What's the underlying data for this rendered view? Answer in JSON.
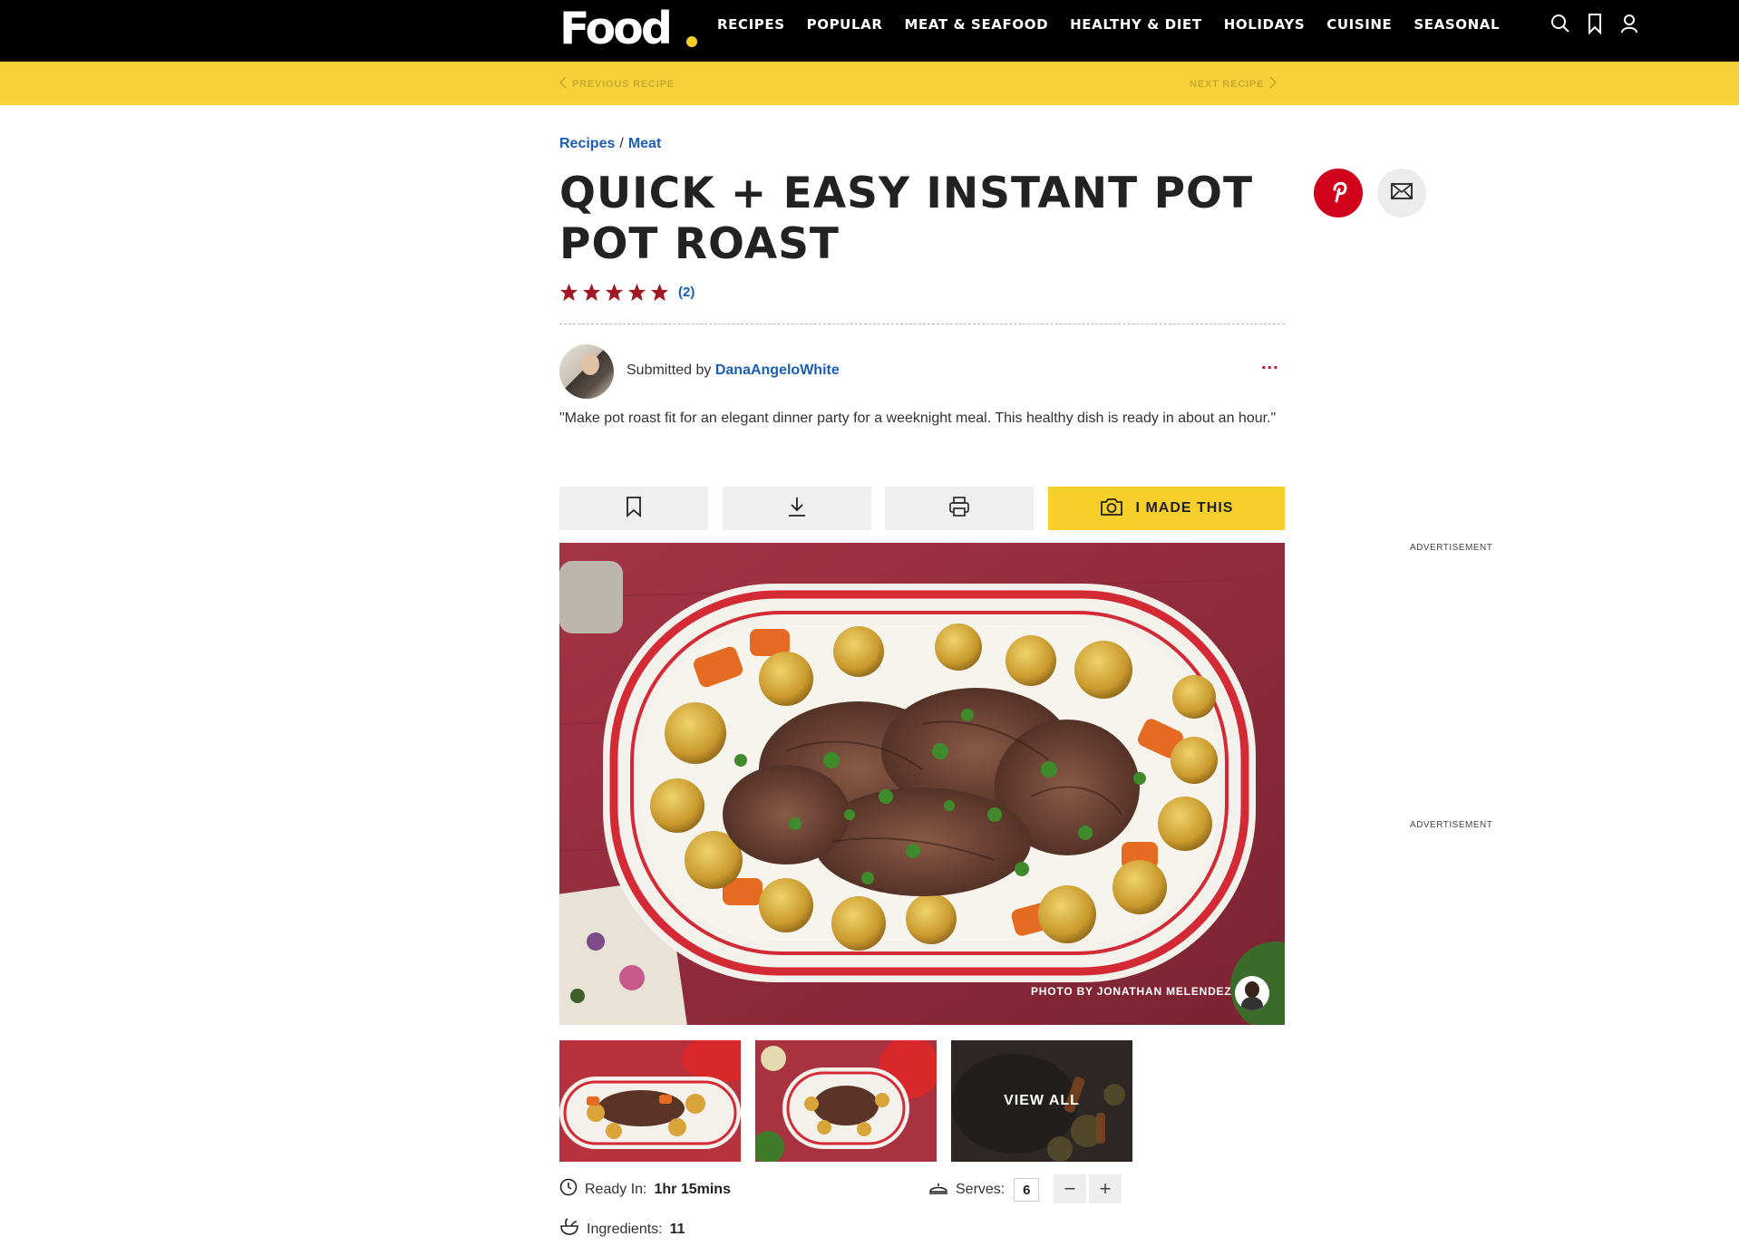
{
  "site": {
    "logo": "Food",
    "nav": [
      "RECIPES",
      "POPULAR",
      "MEAT & SEAFOOD",
      "HEALTHY & DIET",
      "HOLIDAYS",
      "CUISINE",
      "SEASONAL"
    ],
    "icons": [
      "search-icon",
      "bookmark-icon",
      "user-icon"
    ],
    "brand_yellow": "#f7d23a",
    "accent_blue": "#1a5db5"
  },
  "pager": {
    "previous": "PREVIOUS RECIPE",
    "next": "NEXT RECIPE"
  },
  "breadcrumb": {
    "first": "Recipes",
    "separator": "/",
    "second": "Meat"
  },
  "recipe": {
    "title": "QUICK + EASY INSTANT POT POT ROAST",
    "rating_stars": 5,
    "rating_count": "(2)",
    "submitted_prefix": "Submitted by",
    "author": "DanaAngeloWhite",
    "more_label": "...",
    "description": "\"Make pot roast fit for an elegant dinner party for a weeknight meal. This healthy dish is ready in about an hour.\"",
    "made_this": "I MADE THIS",
    "photo_credit": "PHOTO BY JONATHAN MELENDEZ",
    "view_all": "VIEW ALL",
    "ready_label": "Ready In:",
    "ready_value": "1hr 15mins",
    "ingredients_label": "Ingredients:",
    "ingredients_value": "11",
    "serves_label": "Serves:",
    "serves_value": "6",
    "minus": "−",
    "plus": "+"
  },
  "ads": {
    "label": "ADVERTISEMENT"
  }
}
